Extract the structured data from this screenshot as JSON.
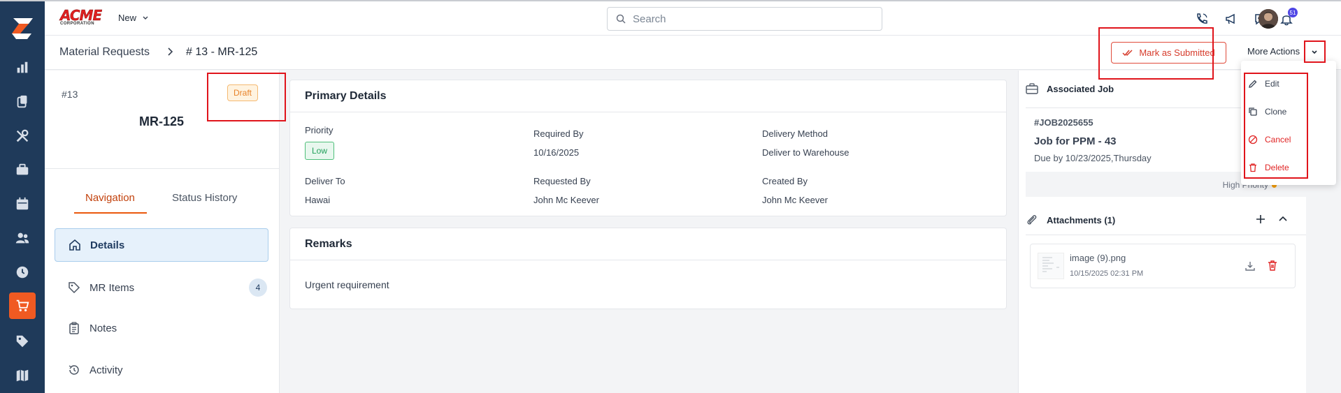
{
  "app": {
    "brand": {
      "name": "ACME",
      "tagline": "CORPORATION"
    },
    "new_label": "New",
    "search": {
      "placeholder": "Search"
    },
    "notifications": {
      "count": "51"
    },
    "rail_items": [
      "dashboard-icon",
      "reports-icon",
      "clipboard-icon",
      "tools-icon",
      "briefcase-icon",
      "calendar-icon",
      "people-icon",
      "clock-icon",
      "cart-icon",
      "tag-icon",
      "map-icon"
    ],
    "active_rail": "cart-icon"
  },
  "breadcrumb": {
    "parent": "Material Requests",
    "separator": ">",
    "current": "# 13 - MR-125"
  },
  "actions": {
    "mark_submitted": "Mark as Submitted",
    "more_actions": "More Actions",
    "menu": [
      {
        "label": "Edit",
        "icon": "pencil-icon",
        "color": "#374151"
      },
      {
        "label": "Clone",
        "icon": "copy-icon",
        "color": "#374151"
      },
      {
        "label": "Cancel",
        "icon": "ban-icon",
        "color": "#e02424"
      },
      {
        "label": "Delete",
        "icon": "trash-icon",
        "color": "#e02424"
      }
    ]
  },
  "record": {
    "number": "#13",
    "status": "Draft",
    "title": "MR-125"
  },
  "left_tabs": [
    {
      "label": "Navigation",
      "active": true
    },
    {
      "label": "Status History",
      "active": false
    }
  ],
  "nav": [
    {
      "label": "Details",
      "icon": "home-icon",
      "active": true
    },
    {
      "label": "MR Items",
      "icon": "tag-icon",
      "count": "4"
    },
    {
      "label": "Notes",
      "icon": "clipboard-icon"
    },
    {
      "label": "Activity",
      "icon": "history-icon"
    }
  ],
  "primary": {
    "title": "Primary Details",
    "priority_label": "Priority",
    "priority_value": "Low",
    "required_by_label": "Required By",
    "required_by_value": "10/16/2025",
    "delivery_method_label": "Delivery Method",
    "delivery_method_value": "Deliver to Warehouse",
    "deliver_to_label": "Deliver To",
    "deliver_to_value": "Hawai",
    "requested_by_label": "Requested By",
    "requested_by_value": "John Mc Keever",
    "created_by_label": "Created By",
    "created_by_value": "John Mc Keever"
  },
  "remarks": {
    "title": "Remarks",
    "text": "Urgent requirement"
  },
  "associated_job": {
    "title": "Associated Job",
    "job_id": "#JOB2025655",
    "job_name": "Job for PPM - 43",
    "due": "Due by 10/23/2025,Thursday",
    "priority": "High Priority"
  },
  "attachments": {
    "title": "Attachments (1)",
    "files": [
      {
        "name": "image (9).png",
        "date": "10/15/2025 02:31 PM"
      }
    ]
  },
  "colors": {
    "rail": "#1f3a5a",
    "accent": "#f05a22",
    "danger": "#e02424",
    "highlight": "#e0141b"
  }
}
